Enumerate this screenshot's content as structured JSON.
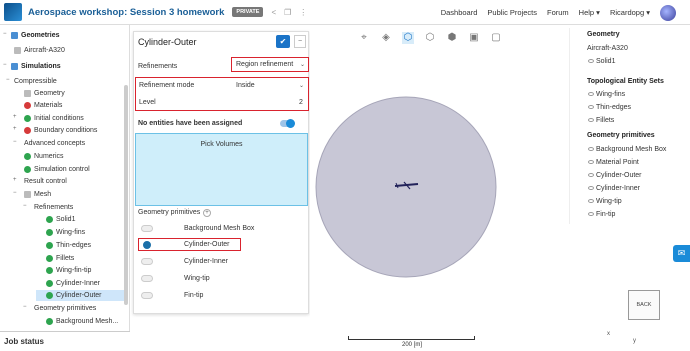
{
  "header": {
    "title": "Aerospace workshop: Session 3 homework",
    "private_badge": "PRIVATE",
    "nav": [
      "Dashboard",
      "Public Projects",
      "Forum",
      "Help ▾",
      "Ricardopg ▾"
    ]
  },
  "tree": {
    "items": [
      {
        "label": "Geometries",
        "bold": true
      },
      {
        "label": "Aircraft-A320"
      },
      {
        "label": "Simulations",
        "bold": true
      },
      {
        "label": "Compressible"
      },
      {
        "label": "Geometry"
      },
      {
        "label": "Materials"
      },
      {
        "label": "Initial conditions"
      },
      {
        "label": "Boundary conditions"
      },
      {
        "label": "Advanced concepts"
      },
      {
        "label": "Numerics"
      },
      {
        "label": "Simulation control"
      },
      {
        "label": "Result control"
      },
      {
        "label": "Mesh"
      },
      {
        "label": "Refinements"
      },
      {
        "label": "Solid1"
      },
      {
        "label": "Wing-fins"
      },
      {
        "label": "Thin-edges"
      },
      {
        "label": "Fillets"
      },
      {
        "label": "Wing-fin-tip"
      },
      {
        "label": "Cylinder-Inner"
      },
      {
        "label": "Cylinder-Outer"
      },
      {
        "label": "Geometry primitives"
      },
      {
        "label": "Background Mesh..."
      }
    ]
  },
  "job_status": "Job status",
  "panel": {
    "title": "Cylinder-Outer",
    "refinements_label": "Refinements",
    "refinements_value": "Region refinement",
    "mode_label": "Refinement mode",
    "mode_value": "Inside",
    "level_label": "Level",
    "level_value": "2",
    "no_entities": "No entities have been assigned",
    "pick_volumes": "Pick Volumes",
    "primitives_label": "Geometry primitives",
    "primitives": [
      "Background Mesh Box",
      "Cylinder-Outer",
      "Cylinder-Inner",
      "Wing-tip",
      "Fin-tip"
    ]
  },
  "right_panel": {
    "geometry_head": "Geometry",
    "geometry_item": "Aircraft-A320",
    "solid": "Solid1",
    "topo_head": "Topological Entity Sets",
    "topo_items": [
      "Wing-fins",
      "Thin-edges",
      "Fillets"
    ],
    "prim_head": "Geometry primitives",
    "prim_items": [
      "Background Mesh Box",
      "Material Point",
      "Cylinder-Outer",
      "Cylinder-Inner",
      "Wing-tip",
      "Fin-tip"
    ]
  },
  "viewport": {
    "scale_label": "200 [m]",
    "back_label": "BACK"
  },
  "colors": {
    "accent": "#1a73c7",
    "highlight": "#d9232e",
    "cylinder": "#c8c7d6"
  }
}
